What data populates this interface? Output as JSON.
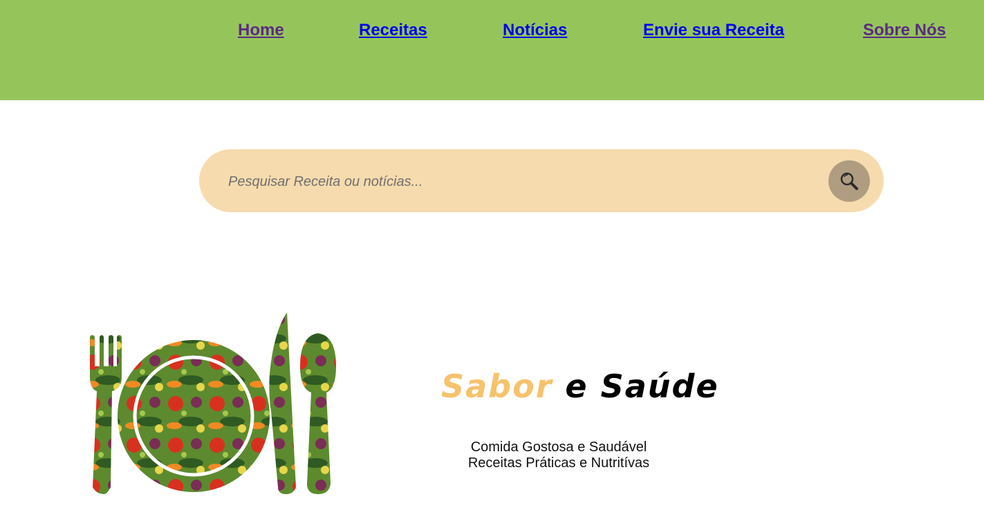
{
  "nav": {
    "items": [
      {
        "label": "Home",
        "state": "visited"
      },
      {
        "label": "Receitas",
        "state": "unvisited"
      },
      {
        "label": "Notícias",
        "state": "unvisited"
      },
      {
        "label": "Envie sua Receita",
        "state": "unvisited"
      },
      {
        "label": "Sobre Nós",
        "state": "visited"
      }
    ]
  },
  "search": {
    "placeholder": "Pesquisar Receita ou notícias...",
    "button_icon": "search-icon"
  },
  "hero": {
    "logo_icon": "plate-cutlery-vegetables-logo",
    "brand_part1": "Sabor",
    "brand_part2": "e Saúde",
    "tagline_line1": "Comida Gostosa e Saudável",
    "tagline_line2": "Receitas Práticas e Nutritívas"
  },
  "colors": {
    "header_bg": "#95c55a",
    "search_bg": "#f6dbae",
    "search_button_bg": "#b09c80",
    "brand_accent": "#f7c26b",
    "link_visited": "#5b2a86",
    "link_unvisited": "#0000ee"
  }
}
